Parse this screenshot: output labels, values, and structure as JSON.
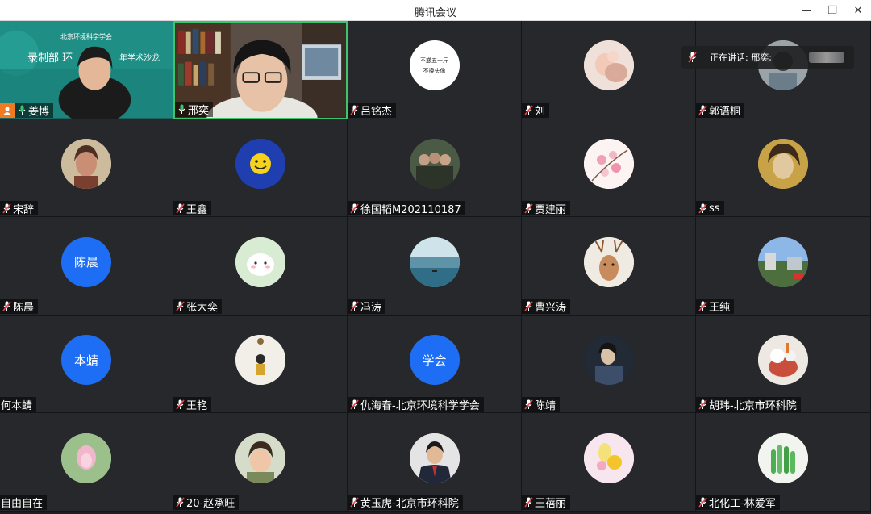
{
  "app": {
    "title": "腾讯会议"
  },
  "window_controls": {
    "minimize": "—",
    "restore": "❐",
    "close": "✕"
  },
  "speaker_indicator": {
    "label": "正在讲话: 邢奕;"
  },
  "video_tiles": {
    "t0": {
      "banner_line1": "北京环境科学学会",
      "banner_line2": "录制部 环",
      "banner_line3": "年学术沙龙"
    },
    "t2": {
      "calligraphy_line1": "不惑五十斤",
      "calligraphy_line2": "不换头像"
    }
  },
  "participants": [
    {
      "name": "姜博",
      "mic": "on",
      "host": true
    },
    {
      "name": "邢奕",
      "mic": "on"
    },
    {
      "name": "吕铭杰",
      "mic": "muted"
    },
    {
      "name": "刘",
      "mic": "muted"
    },
    {
      "name": "郭语桐",
      "mic": "muted"
    },
    {
      "name": "宋辞",
      "mic": "muted"
    },
    {
      "name": "王鑫",
      "mic": "muted"
    },
    {
      "name": "徐国韬M202110187",
      "mic": "muted"
    },
    {
      "name": "贾建丽",
      "mic": "muted"
    },
    {
      "name": "ss",
      "mic": "muted"
    },
    {
      "name": "陈晨",
      "mic": "muted",
      "avatar_text": "陈晨"
    },
    {
      "name": "张大奕",
      "mic": "muted"
    },
    {
      "name": "冯涛",
      "mic": "muted"
    },
    {
      "name": "曹兴涛",
      "mic": "muted"
    },
    {
      "name": "王纯",
      "mic": "muted"
    },
    {
      "name": "何本蜻",
      "mic": "none",
      "avatar_text": "本蜻"
    },
    {
      "name": "王艳",
      "mic": "muted"
    },
    {
      "name": "仇海春-北京环境科学学会",
      "mic": "muted",
      "avatar_text": "学会"
    },
    {
      "name": "陈靖",
      "mic": "muted"
    },
    {
      "name": "胡玮-北京市环科院",
      "mic": "muted"
    },
    {
      "name": "自由自在",
      "mic": "none"
    },
    {
      "name": "20-赵承旺",
      "mic": "muted"
    },
    {
      "name": "黄玉虎-北京市环科院",
      "mic": "muted"
    },
    {
      "name": "王蓓丽",
      "mic": "muted"
    },
    {
      "name": "北化工-林爱军",
      "mic": "muted"
    }
  ],
  "colors": {
    "accent_blue": "#1e6ef5",
    "host_orange": "#f07a22",
    "mic_on_green": "#3ec46d",
    "mic_muted_red": "#e5484d"
  }
}
